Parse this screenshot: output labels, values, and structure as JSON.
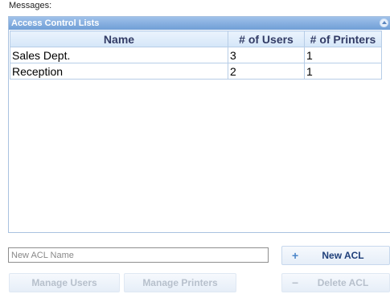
{
  "messages_label": "Messages:",
  "panel": {
    "title": "Access Control Lists"
  },
  "table": {
    "headers": [
      "Name",
      "# of Users",
      "# of Printers"
    ],
    "rows": [
      {
        "name": "Sales Dept.",
        "users": "3",
        "printers": "1"
      },
      {
        "name": "Reception",
        "users": "2",
        "printers": "1"
      }
    ]
  },
  "form": {
    "acl_name_placeholder": "New ACL Name",
    "new_acl_label": "New ACL",
    "new_acl_symbol": "+",
    "delete_acl_label": "Delete ACL",
    "delete_acl_symbol": "−",
    "manage_users_label": "Manage Users",
    "manage_printers_label": "Manage Printers"
  },
  "colors": {
    "header_blue": "#6f9ed6",
    "header_text": "#333c66",
    "disabled_text": "#b7c0cc"
  }
}
